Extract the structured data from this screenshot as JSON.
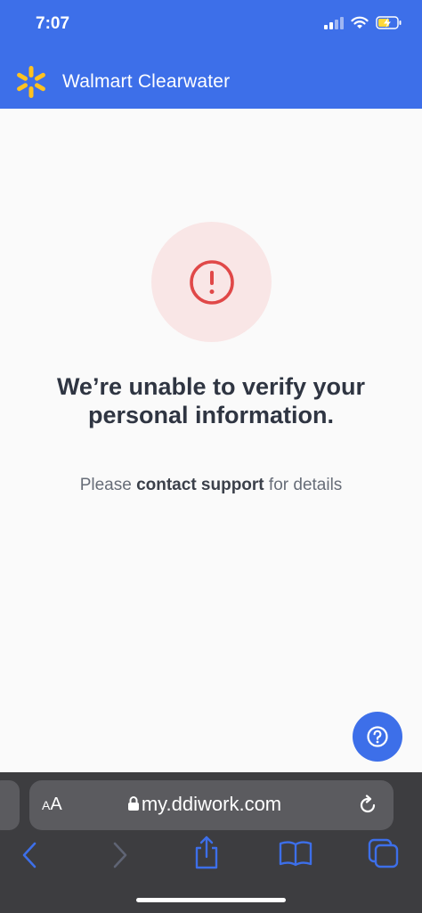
{
  "status_bar": {
    "time": "7:07"
  },
  "header": {
    "store_name": "Walmart Clearwater"
  },
  "message": {
    "headline": "We’re unable to verify your personal information.",
    "prefix": "Please ",
    "link_text": "contact support",
    "suffix": " for details"
  },
  "browser": {
    "text_size_label_small": "A",
    "text_size_label_large": "A",
    "url": "my.ddiwork.com"
  },
  "colors": {
    "brand_blue": "#3d6fe9",
    "spark_yellow": "#ffc220",
    "alert_red": "#e04848",
    "alert_bg": "#f9e6e6"
  }
}
